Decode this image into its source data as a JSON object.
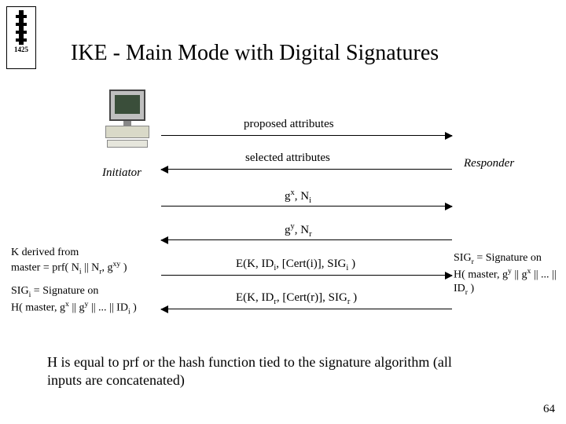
{
  "title": "IKE - Main Mode with Digital Signatures",
  "roles": {
    "initiator": "Initiator",
    "responder": "Responder"
  },
  "messages": {
    "m1": "proposed attributes",
    "m2": "selected attributes",
    "m3_html": "g<sup>x</sup>, N<sub>i</sub>",
    "m4_html": "g<sup>y</sup>, N<sub>r</sub>",
    "m5_html": "E(K, ID<sub>i</sub>, [Cert(i)], SIG<sub>i</sub> )",
    "m6_html": "E(K, ID<sub>r</sub>, [Cert(r)], SIG<sub>r</sub> )"
  },
  "notes": {
    "left1_html": "K derived from<br>master = prf( N<sub>i</sub> || N<sub>r</sub>, g<sup>xy</sup> )",
    "left2_html": "SIG<sub>i</sub> = Signature on<br>H( master, g<sup>x</sup> || g<sup>y</sup> || ... || ID<sub>i</sub> )",
    "right_html": "SIG<sub>r</sub> = Signature on<br>H( master, g<sup>y</sup> || g<sup>x</sup> || ... || ID<sub>r</sub> )"
  },
  "footer": "H is equal to prf or the hash function tied to the signature algorithm (all inputs are concatenated)",
  "page_number": "64",
  "logo_year": "1425"
}
